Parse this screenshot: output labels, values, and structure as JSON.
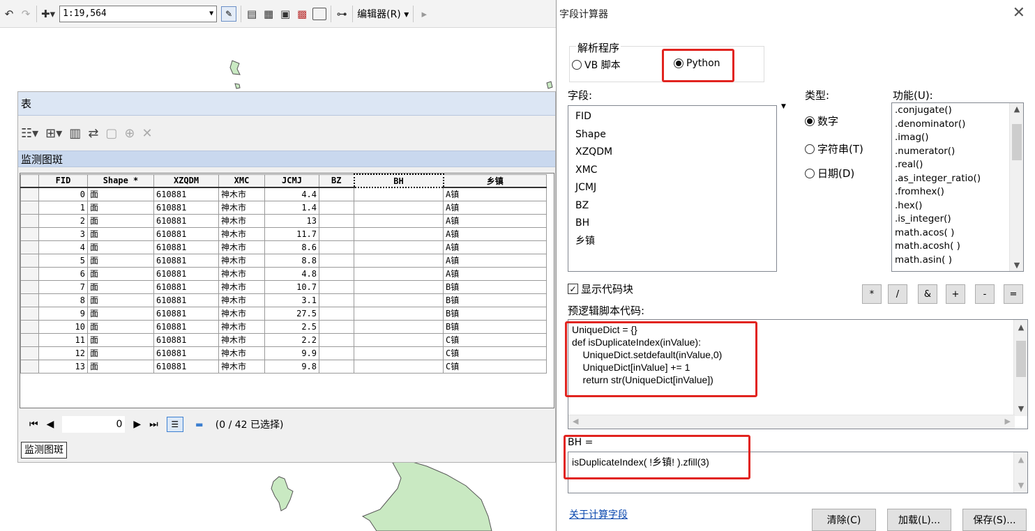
{
  "toolbar": {
    "scale": "1:19,564",
    "editor_menu": "编辑器(R)"
  },
  "table_window": {
    "title": "表",
    "tab_label": "监测图斑",
    "bottom_tab": "监测图斑",
    "nav_position": "0",
    "selection_status": "(0 / 42 已选择)",
    "columns": [
      "FID",
      "Shape *",
      "XZQDM",
      "XMC",
      "JCMJ",
      "BZ",
      "BH",
      "乡镇"
    ],
    "rows": [
      [
        "0",
        "面",
        "610881",
        "神木市",
        "4.4",
        "",
        "",
        "A镇"
      ],
      [
        "1",
        "面",
        "610881",
        "神木市",
        "1.4",
        "",
        "",
        "A镇"
      ],
      [
        "2",
        "面",
        "610881",
        "神木市",
        "13",
        "",
        "",
        "A镇"
      ],
      [
        "3",
        "面",
        "610881",
        "神木市",
        "11.7",
        "",
        "",
        "A镇"
      ],
      [
        "4",
        "面",
        "610881",
        "神木市",
        "8.6",
        "",
        "",
        "A镇"
      ],
      [
        "5",
        "面",
        "610881",
        "神木市",
        "8.8",
        "",
        "",
        "A镇"
      ],
      [
        "6",
        "面",
        "610881",
        "神木市",
        "4.8",
        "",
        "",
        "A镇"
      ],
      [
        "7",
        "面",
        "610881",
        "神木市",
        "10.7",
        "",
        "",
        "B镇"
      ],
      [
        "8",
        "面",
        "610881",
        "神木市",
        "3.1",
        "",
        "",
        "B镇"
      ],
      [
        "9",
        "面",
        "610881",
        "神木市",
        "27.5",
        "",
        "",
        "B镇"
      ],
      [
        "10",
        "面",
        "610881",
        "神木市",
        "2.5",
        "",
        "",
        "B镇"
      ],
      [
        "11",
        "面",
        "610881",
        "神木市",
        "2.2",
        "",
        "",
        "C镇"
      ],
      [
        "12",
        "面",
        "610881",
        "神木市",
        "9.9",
        "",
        "",
        "C镇"
      ],
      [
        "13",
        "面",
        "610881",
        "神木市",
        "9.8",
        "",
        "",
        "C镇"
      ]
    ]
  },
  "dialog": {
    "title": "字段计算器",
    "parser": {
      "label": "解析程序",
      "options": [
        "VB 脚本",
        "Python"
      ],
      "selected": "Python"
    },
    "fields_label": "字段:",
    "fields": [
      "FID",
      "Shape",
      "XZQDM",
      "XMC",
      "JCMJ",
      "BZ",
      "BH",
      "乡镇"
    ],
    "type_label": "类型:",
    "types": [
      "数字",
      "字符串(T)",
      "日期(D)"
    ],
    "selected_type": "数字",
    "functions_label": "功能(U):",
    "functions": [
      ".conjugate()",
      ".denominator()",
      ".imag()",
      ".numerator()",
      ".real()",
      ".as_integer_ratio()",
      ".fromhex()",
      ".hex()",
      ".is_integer()",
      "math.acos( )",
      "math.acosh( )",
      "math.asin( )"
    ],
    "show_codeblock_label": "显示代码块",
    "show_codeblock_checked": true,
    "operators": [
      "*",
      "/",
      "&",
      "+",
      "-",
      "="
    ],
    "prelogic_label": "预逻辑脚本代码:",
    "prelogic_code": [
      "UniqueDict = {}",
      "def isDuplicateIndex(inValue):",
      "    UniqueDict.setdefault(inValue,0)",
      "    UniqueDict[inValue] += 1",
      "    return str(UniqueDict[inValue])"
    ],
    "expression_label": "BH =",
    "expression": "isDuplicateIndex( !乡镇! ).zfill(3)",
    "about_link": "关于计算字段",
    "buttons": {
      "clear": "清除(C)",
      "load": "加载(L)...",
      "save": "保存(S)..."
    }
  }
}
